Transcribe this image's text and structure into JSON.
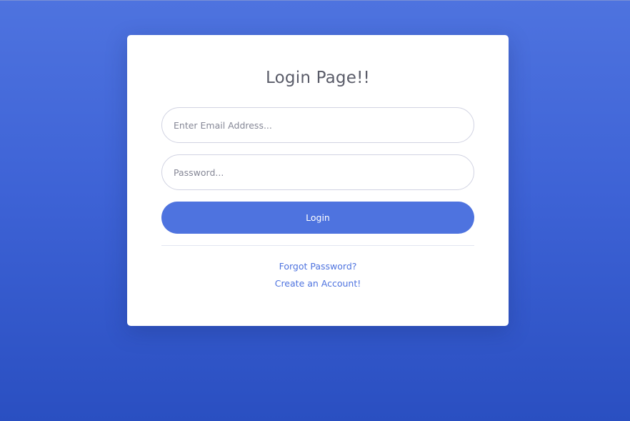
{
  "login_card": {
    "title": "Login Page!!",
    "email_placeholder": "Enter Email Address...",
    "password_placeholder": "Password...",
    "login_button_label": "Login",
    "forgot_password_link": "Forgot Password?",
    "create_account_link": "Create an Account!"
  },
  "colors": {
    "background_top": "#4e73df",
    "background_bottom": "#2a4fc1",
    "primary": "#4e73df",
    "title_text": "#5a5c69",
    "input_border": "#d1d3e2"
  }
}
